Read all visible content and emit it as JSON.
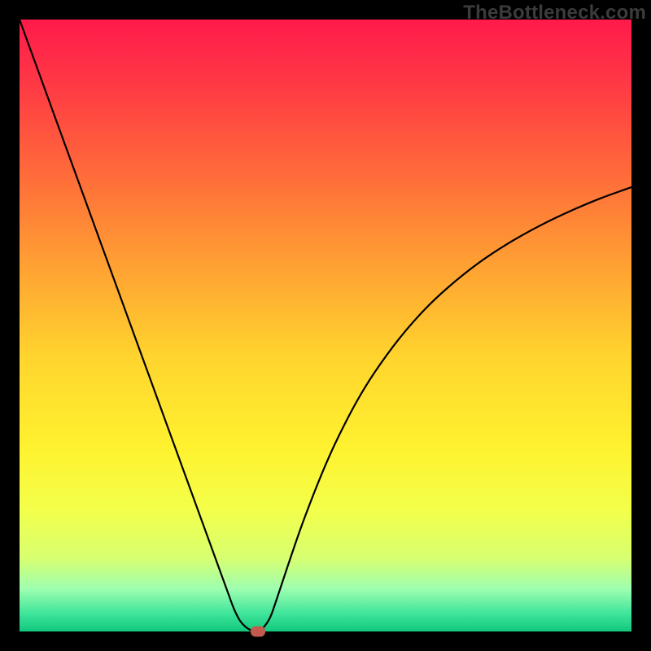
{
  "watermark": "TheBottleneck.com",
  "chart_data": {
    "type": "line",
    "title": "",
    "xlabel": "",
    "ylabel": "",
    "xlim": [
      0,
      100
    ],
    "ylim": [
      0,
      100
    ],
    "background_gradient": {
      "stops": [
        {
          "pos": 0.0,
          "color": "#ff1a4b"
        },
        {
          "pos": 0.1,
          "color": "#ff3745"
        },
        {
          "pos": 0.25,
          "color": "#ff6a3a"
        },
        {
          "pos": 0.4,
          "color": "#ffa033"
        },
        {
          "pos": 0.55,
          "color": "#ffd42e"
        },
        {
          "pos": 0.7,
          "color": "#fff22f"
        },
        {
          "pos": 0.8,
          "color": "#f3ff4a"
        },
        {
          "pos": 0.88,
          "color": "#d7ff70"
        },
        {
          "pos": 0.93,
          "color": "#9fffb0"
        },
        {
          "pos": 0.97,
          "color": "#40e59b"
        },
        {
          "pos": 1.0,
          "color": "#11c87d"
        }
      ]
    },
    "series": [
      {
        "name": "bottleneck-curve",
        "color": "#000000",
        "width": 2.2,
        "x": [
          0,
          2,
          4,
          6,
          8,
          10,
          12,
          14,
          16,
          18,
          20,
          22,
          24,
          26,
          28,
          30,
          32,
          34,
          35,
          36,
          37,
          37.8,
          38.5,
          39.2,
          40,
          41,
          42,
          44,
          46,
          48,
          50,
          52,
          55,
          58,
          62,
          66,
          70,
          75,
          80,
          85,
          90,
          95,
          100
        ],
        "y": [
          100,
          94.5,
          89,
          83.5,
          78,
          72.5,
          67,
          61.5,
          56,
          50.5,
          45,
          39.5,
          34,
          28.5,
          23,
          17.5,
          12,
          6.5,
          3.8,
          1.8,
          0.7,
          0.2,
          0.0,
          0.2,
          0.8,
          2.4,
          5.2,
          11.2,
          17.0,
          22.3,
          27.2,
          31.6,
          37.4,
          42.3,
          47.8,
          52.4,
          56.2,
          60.2,
          63.5,
          66.3,
          68.7,
          70.8,
          72.6
        ]
      }
    ],
    "marker": {
      "x": 38.9,
      "y": 0.0,
      "color": "#c25b4e"
    }
  }
}
